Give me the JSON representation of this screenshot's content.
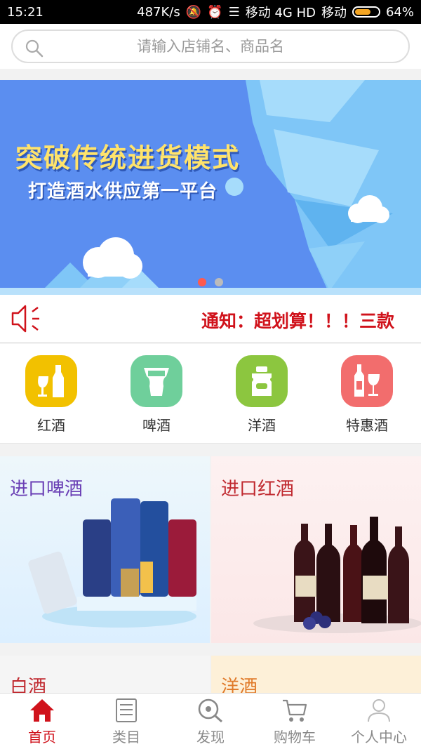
{
  "status_bar": {
    "time": "15:21",
    "speed": "487K/s",
    "carrier1": "移动 4G HD",
    "carrier2": "移动",
    "battery": "64%",
    "battery_level": 0.64
  },
  "search": {
    "placeholder": "请输入店铺名、商品名"
  },
  "banner": {
    "title": "突破传统进货模式",
    "subtitle": "打造酒水供应第一平台",
    "active_dot": 0,
    "dot_count": 2
  },
  "notice": {
    "text": "通知：超划算！！！三款"
  },
  "categories": [
    {
      "label": "红酒",
      "color": "#f2c100"
    },
    {
      "label": "啤酒",
      "color": "#6fcf9b"
    },
    {
      "label": "洋酒",
      "color": "#8cc63f"
    },
    {
      "label": "特惠酒",
      "color": "#f26d6d"
    }
  ],
  "tiles": {
    "beer": {
      "title": "进口啤酒",
      "color": "#6a3fb5"
    },
    "wine": {
      "title": "进口红酒",
      "color": "#c0292f"
    },
    "baijiu": {
      "title": "白酒",
      "color": "#c0292f"
    },
    "foreign": {
      "title": "洋酒",
      "color": "#e07a2a"
    }
  },
  "bottom_nav": [
    {
      "label": "首页",
      "icon": "home-icon",
      "active": true
    },
    {
      "label": "类目",
      "icon": "list-icon",
      "active": false
    },
    {
      "label": "发现",
      "icon": "discover-icon",
      "active": false
    },
    {
      "label": "购物车",
      "icon": "cart-icon",
      "active": false
    },
    {
      "label": "个人中心",
      "icon": "user-icon",
      "active": false
    }
  ]
}
